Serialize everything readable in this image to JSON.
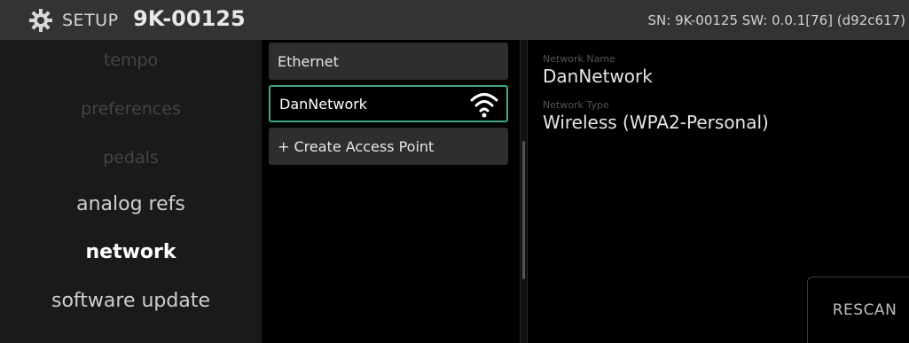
{
  "header": {
    "setup_label": "SETUP",
    "device_id": "9K-00125",
    "sn_info": "SN: 9K-00125 SW: 0.0.1[76] (d92c617)"
  },
  "menu": {
    "items": [
      {
        "label": "tempo"
      },
      {
        "label": "preferences"
      },
      {
        "label": "pedals"
      },
      {
        "label": "analog refs"
      },
      {
        "label": "network"
      },
      {
        "label": "software update"
      }
    ]
  },
  "networks": {
    "items": [
      {
        "label": "Ethernet"
      },
      {
        "label": "DanNetwork"
      },
      {
        "label": "+ Create Access Point"
      }
    ],
    "selected_icon": "wifi-icon"
  },
  "details": {
    "network_name_label": "Network Name",
    "network_name": "DanNetwork",
    "network_type_label": "Network Type",
    "network_type": "Wireless (WPA2-Personal)"
  },
  "actions": {
    "rescan_label": "RESCAN"
  },
  "colors": {
    "accent": "#3fa58b",
    "header_bg": "#333333",
    "menu_bg": "#1a1a1a"
  }
}
